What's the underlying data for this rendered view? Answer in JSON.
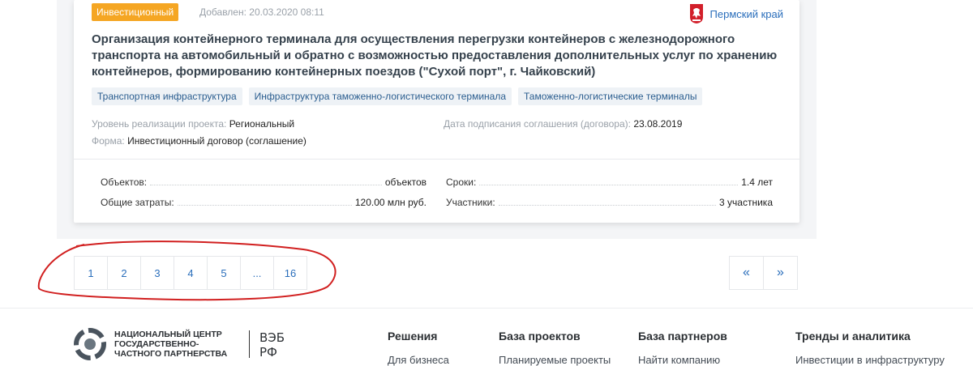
{
  "card": {
    "badge": "Инвестиционный",
    "added": "Добавлен: 20.03.2020 08:11",
    "region": "Пермский край",
    "title": "Организация контейнерного терминала для осуществления перегрузки контейнеров с железнодорожного транспорта на автомобильный и обратно с возможностью предоставления дополнительных услуг по хранению контейнеров, формированию контейнерных поездов (\"Сухой порт\", г. Чайковский)",
    "tags": [
      "Транспортная инфраструктура",
      "Инфраструктура таможенно-логистического терминала",
      "Таможенно-логистические терминалы"
    ],
    "meta": {
      "level_label": "Уровень реализации проекта:",
      "level_value": "Региональный",
      "date_label": "Дата подписания соглашения (договора):",
      "date_value": "23.08.2019",
      "form_label": "Форма:",
      "form_value": "Инвестиционный договор (соглашение)"
    },
    "stats": {
      "objects_label": "Объектов:",
      "objects_value": "объектов",
      "terms_label": "Сроки:",
      "terms_value": "1.4 лет",
      "costs_label": "Общие затраты:",
      "costs_value": "120.00 млн руб.",
      "participants_label": "Участники:",
      "participants_value": "3 участника"
    }
  },
  "pagination": {
    "pages": [
      "1",
      "2",
      "3",
      "4",
      "5",
      "...",
      "16"
    ],
    "prev": "«",
    "next": "»"
  },
  "footer": {
    "logo_text": "Национальный центр государственно-частного партнерства",
    "columns": [
      {
        "heading": "Решения",
        "link": "Для бизнеса"
      },
      {
        "heading": "База проектов",
        "link": "Планируемые проекты"
      },
      {
        "heading": "База партнеров",
        "link": "Найти компанию"
      },
      {
        "heading": "Тренды и аналитика",
        "link": "Инвестиции в инфраструктуру"
      }
    ]
  },
  "colors": {
    "accent": "#2a6ebb",
    "badge": "#f5a623",
    "annotation": "#d11f1f"
  }
}
